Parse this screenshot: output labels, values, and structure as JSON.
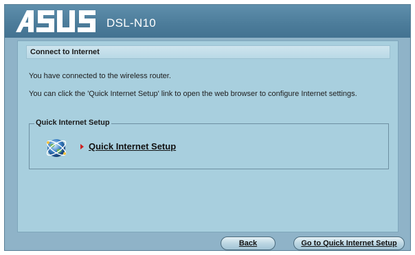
{
  "header": {
    "brand": "ASUS",
    "model": "DSL-N10"
  },
  "section": {
    "title": "Connect to Internet"
  },
  "messages": {
    "line1": "You have connected to the wireless router.",
    "line2": "You can click the 'Quick Internet Setup' link to open the web browser to configure Internet settings."
  },
  "group": {
    "title": "Quick Internet Setup",
    "link_label": "Quick Internet Setup",
    "icon": "globe-network-icon",
    "arrow_icon": "arrow-right-icon"
  },
  "buttons": {
    "back_label": "Back",
    "go_label": "Go to Quick Internet Setup"
  },
  "colors": {
    "header": "#4d7d9b",
    "panel": "#a8cfde",
    "frame": "#8fb3c8",
    "arrow": "#cc2222"
  }
}
